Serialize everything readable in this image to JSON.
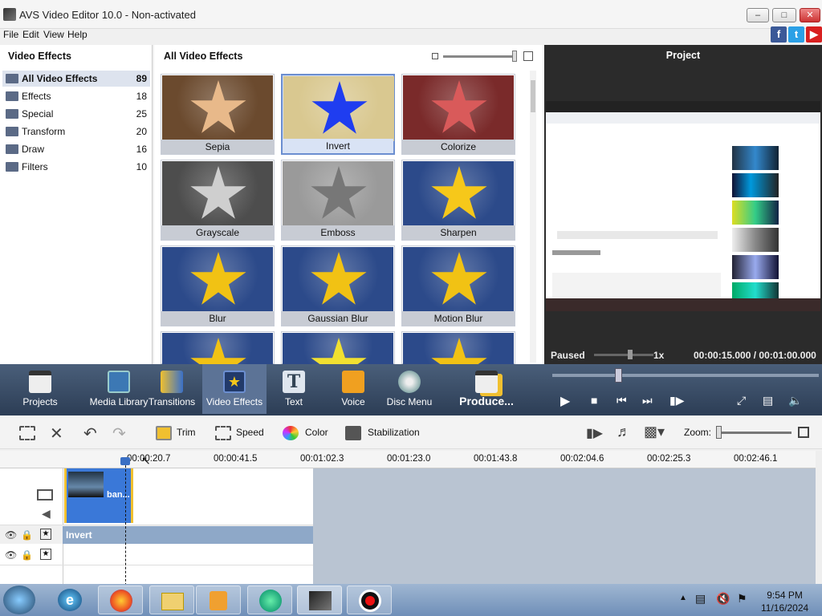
{
  "window": {
    "title": "AVS Video Editor 10.0 - Non-activated"
  },
  "menu": {
    "items": [
      "File",
      "Edit",
      "View",
      "Help"
    ]
  },
  "social": [
    "facebook-icon",
    "twitter-icon",
    "youtube-icon"
  ],
  "categories": {
    "header": "Video Effects",
    "items": [
      {
        "label": "All Video Effects",
        "count": "89",
        "selected": true
      },
      {
        "label": "Effects",
        "count": "18"
      },
      {
        "label": "Special",
        "count": "25"
      },
      {
        "label": "Transform",
        "count": "20"
      },
      {
        "label": "Draw",
        "count": "16"
      },
      {
        "label": "Filters",
        "count": "10"
      }
    ]
  },
  "effects": {
    "header": "All Video Effects",
    "items": [
      {
        "label": "Sepia",
        "bg": "#6b4a2e",
        "star": "#e8b98a"
      },
      {
        "label": "Invert",
        "bg": "#d9c890",
        "star": "#1f3df0",
        "selected": true
      },
      {
        "label": "Colorize",
        "bg": "#7a2a2a",
        "star": "#d95a5a"
      },
      {
        "label": "Grayscale",
        "bg": "#4d4d4d",
        "star": "#cfcfcf"
      },
      {
        "label": "Emboss",
        "bg": "#9a9a9a",
        "star": "#777777"
      },
      {
        "label": "Sharpen",
        "bg": "#2c4a8a",
        "star": "#f6c81a"
      },
      {
        "label": "Blur",
        "bg": "#2c4a8a",
        "star": "#f1c214"
      },
      {
        "label": "Gaussian Blur",
        "bg": "#2c4a8a",
        "star": "#f1c214"
      },
      {
        "label": "Motion Blur",
        "bg": "#2c4a8a",
        "star": "#f1c214"
      },
      {
        "label": "",
        "bg": "#2c4a8a",
        "star": "#f1c214"
      },
      {
        "label": "",
        "bg": "#2c4a8a",
        "star": "#f1e030"
      },
      {
        "label": "",
        "bg": "#2c4a8a",
        "star": "#f1c214"
      }
    ]
  },
  "project": {
    "title": "Project",
    "status": "Paused",
    "speed": "1x",
    "time_current": "00:00:15.000",
    "time_sep": "/",
    "time_total": "00:01:00.000"
  },
  "tabs": [
    {
      "label": "Projects",
      "icon": "clapperboard-icon"
    },
    {
      "label": "Media Library",
      "icon": "film-icon"
    },
    {
      "label": "Transitions",
      "icon": "transitions-icon"
    },
    {
      "label": "Video Effects",
      "icon": "star-icon",
      "selected": true
    },
    {
      "label": "Text",
      "icon": "text-icon"
    },
    {
      "label": "Voice",
      "icon": "microphone-icon"
    },
    {
      "label": "Disc Menu",
      "icon": "disc-icon"
    },
    {
      "label": "Produce...",
      "icon": "produce-icon"
    }
  ],
  "edit_tools": {
    "trim": "Trim",
    "speed": "Speed",
    "color": "Color",
    "stabilization": "Stabilization",
    "zoom": "Zoom:"
  },
  "ruler": [
    "00:00:20.7",
    "00:00:41.5",
    "00:01:02.3",
    "00:01:23.0",
    "00:01:43.8",
    "00:02:04.6",
    "00:02:25.3",
    "00:02:46.1"
  ],
  "timeline": {
    "clip_label": "ban...",
    "effect_label": "Invert"
  },
  "clock": {
    "time": "9:54 PM",
    "date": "11/16/2024"
  }
}
